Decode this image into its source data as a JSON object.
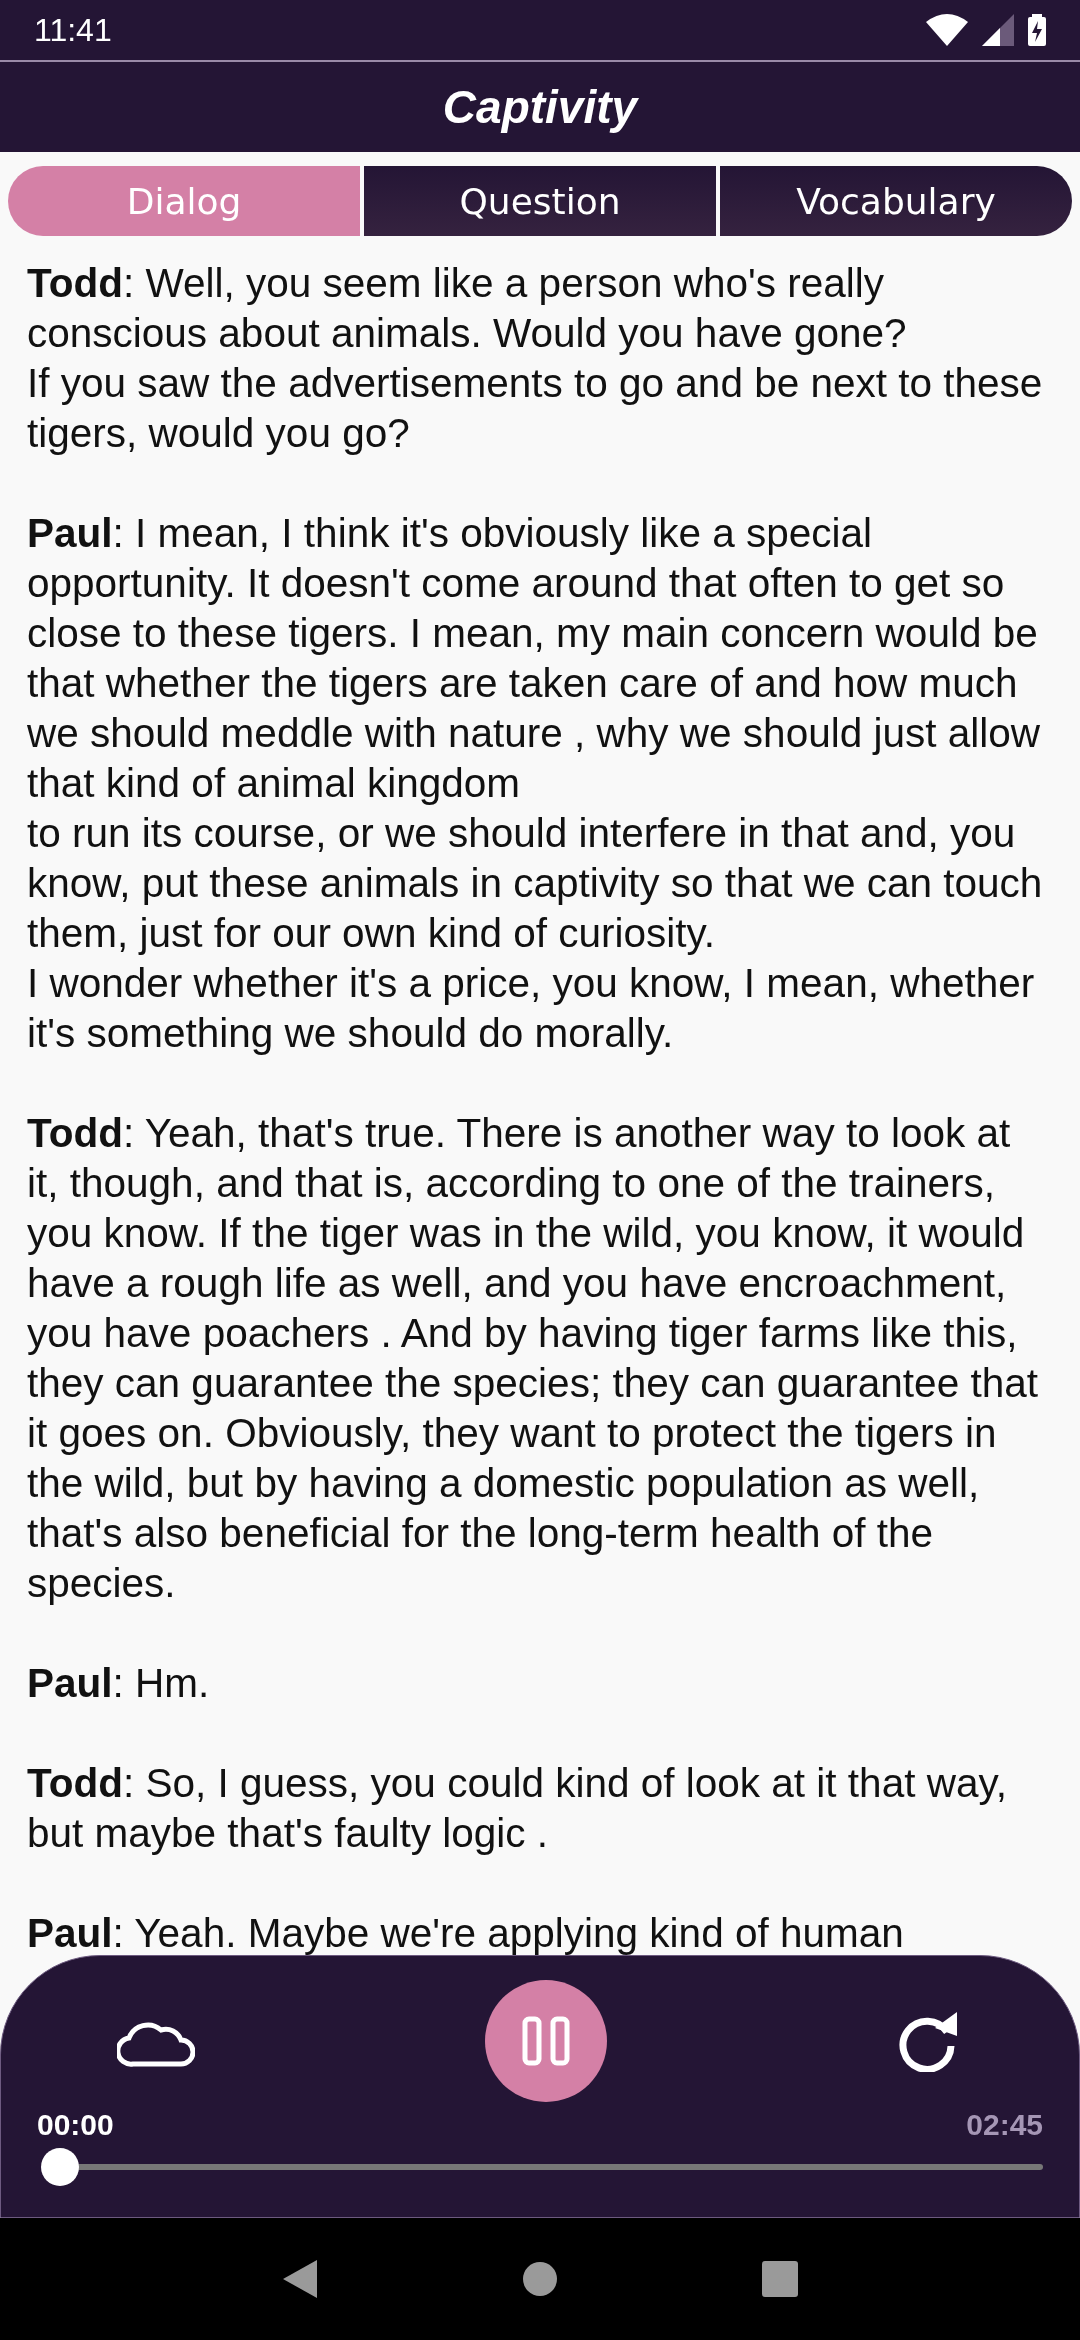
{
  "status_bar": {
    "time": "11:41"
  },
  "title": "Captivity",
  "tabs": [
    {
      "label": "Dialog",
      "selected": true
    },
    {
      "label": "Question",
      "selected": false
    },
    {
      "label": "Vocabulary",
      "selected": false
    }
  ],
  "dialog": [
    {
      "speaker": "Todd",
      "text": ": Well, you seem like a person who's really conscious about animals. Would you have gone?\nIf you saw the advertisements to go and be next to these tigers, would you go?"
    },
    {
      "speaker": "Paul",
      "text": ": I mean, I think it's obviously like a special opportunity. It doesn't come around that often to get so close to these tigers. I mean, my main concern would be that whether the tigers are taken care of and how much we should meddle with nature , why we should just allow that kind of animal kingdom\nto run its course, or we should interfere in that and, you know, put these animals in captivity so that we can touch them, just for our own kind of curiosity.\nI wonder whether it's a price, you know, I mean, whether it's something we should do morally."
    },
    {
      "speaker": "Todd",
      "text": ": Yeah, that's true. There is another way to look at it, though, and that is, according to one of the trainers, you know. If the tiger was in the wild, you know, it would have a rough life as well, and you have encroachment, you have poachers . And by having tiger farms like this, they can guarantee the species; they can guarantee that it goes on. Obviously, they want to protect the tigers in the wild, but by having a domestic population as well, that's also beneficial for the long-term health of the species."
    },
    {
      "speaker": "Paul",
      "text": ": Hm."
    },
    {
      "speaker": "Todd",
      "text": ": So, I guess, you could kind of look at it that way, but maybe that's faulty logic ."
    },
    {
      "speaker": "Paul",
      "text": ": Yeah. Maybe we're applying kind of human"
    }
  ],
  "player": {
    "playing": true,
    "elapsed": "00:00",
    "duration": "02:45",
    "level": 0
  }
}
